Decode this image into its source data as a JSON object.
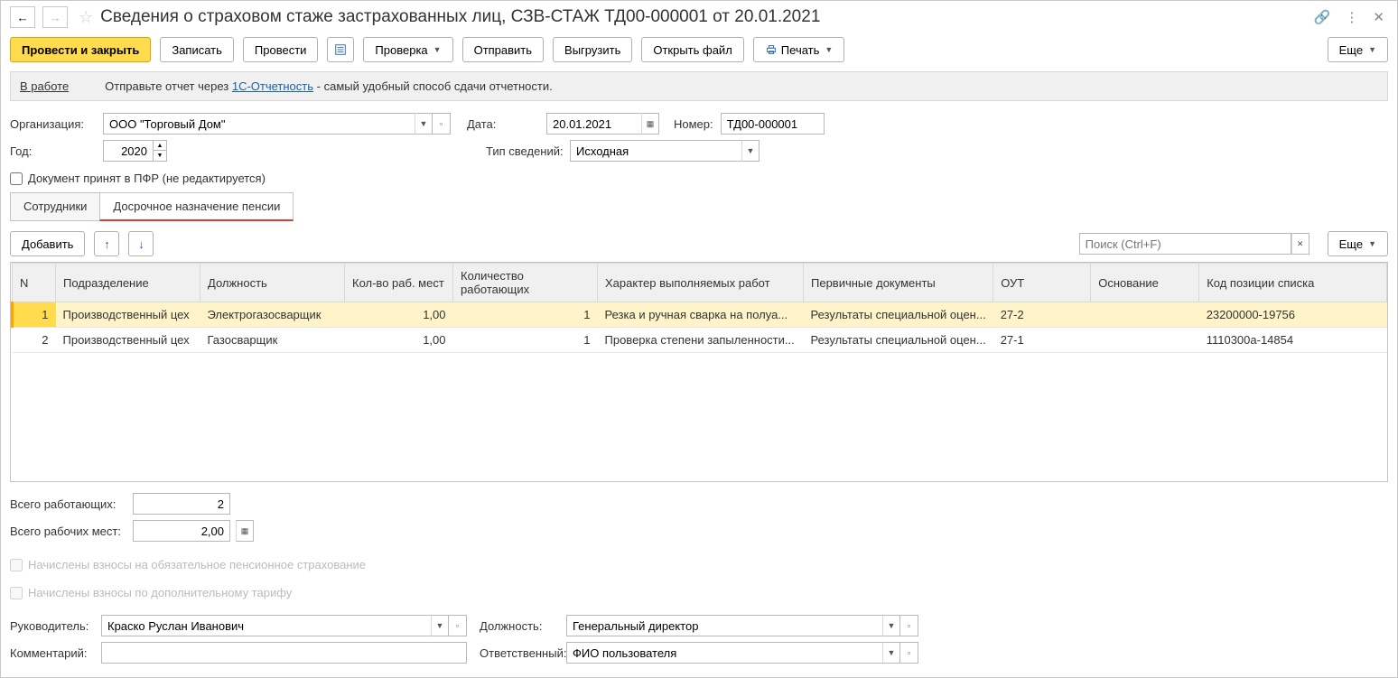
{
  "header": {
    "title": "Сведения о страховом стаже застрахованных лиц, СЗВ-СТАЖ ТД00-000001 от 20.01.2021"
  },
  "toolbar": {
    "post_close": "Провести и закрыть",
    "save": "Записать",
    "post": "Провести",
    "check": "Проверка",
    "send": "Отправить",
    "export": "Выгрузить",
    "open_file": "Открыть файл",
    "print": "Печать",
    "more": "Еще"
  },
  "info": {
    "status": "В работе",
    "text1": "Отправьте отчет через ",
    "link": "1С-Отчетность",
    "text2": " - самый удобный способ сдачи отчетности."
  },
  "form": {
    "org_label": "Организация:",
    "org_value": "ООО \"Торговый Дом\"",
    "date_label": "Дата:",
    "date_value": "20.01.2021",
    "num_label": "Номер:",
    "num_value": "ТД00-000001",
    "year_label": "Год:",
    "year_value": "2020",
    "type_label": "Тип сведений:",
    "type_value": "Исходная",
    "pfr_check": "Документ принят в ПФР (не редактируется)"
  },
  "tabs": {
    "t1": "Сотрудники",
    "t2": "Досрочное назначение пенсии"
  },
  "tab_toolbar": {
    "add": "Добавить",
    "search_placeholder": "Поиск (Ctrl+F)",
    "more": "Еще"
  },
  "table": {
    "headers": {
      "n": "N",
      "dep": "Подразделение",
      "pos": "Должность",
      "qty_places": "Кол-во раб. мест",
      "qty_workers": "Количество работающих",
      "char": "Характер выполняемых работ",
      "docs": "Первичные документы",
      "out": "ОУТ",
      "osn": "Основание",
      "code": "Код позиции списка"
    },
    "rows": [
      {
        "n": "1",
        "dep": "Производственный цех",
        "pos": "Электрогазосварщик",
        "q1": "1,00",
        "q2": "1",
        "char": "Резка и ручная сварка на полуа...",
        "docs": "Результаты специальной оцен...",
        "out": "27-2",
        "osn": "",
        "code": "23200000-19756"
      },
      {
        "n": "2",
        "dep": "Производственный цех",
        "pos": "Газосварщик",
        "q1": "1,00",
        "q2": "1",
        "char": "Проверка степени запыленности...",
        "docs": "Результаты специальной оцен...",
        "out": "27-1",
        "osn": "",
        "code": "1110300а-14854"
      }
    ]
  },
  "totals": {
    "workers_label": "Всего работающих:",
    "workers_value": "2",
    "places_label": "Всего рабочих мест:",
    "places_value": "2,00"
  },
  "checks": {
    "c1": "Начислены взносы на обязательное пенсионное страхование",
    "c2": "Начислены взносы по дополнительному тарифу"
  },
  "footer": {
    "head_label": "Руководитель:",
    "head_value": "Краско Руслан Иванович",
    "pos_label": "Должность:",
    "pos_value": "Генеральный директор",
    "comment_label": "Комментарий:",
    "resp_label": "Ответственный:",
    "resp_value": "ФИО пользователя"
  }
}
